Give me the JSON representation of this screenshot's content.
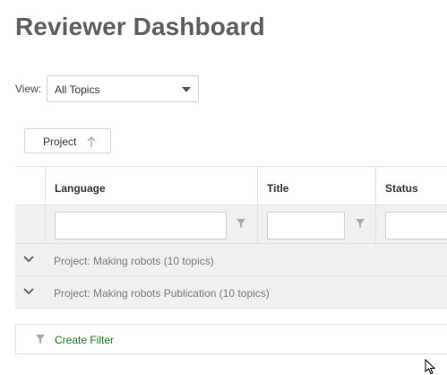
{
  "page": {
    "title": "Reviewer Dashboard"
  },
  "view": {
    "label": "View:",
    "selected": "All Topics"
  },
  "grouping": {
    "chip_label": "Project",
    "sort_direction": "ascending"
  },
  "grid": {
    "columns": [
      {
        "key": "language",
        "label": "Language"
      },
      {
        "key": "title",
        "label": "Title"
      },
      {
        "key": "status",
        "label": "Status"
      }
    ],
    "filters": {
      "language": "",
      "title": "",
      "status": ""
    },
    "groups": [
      {
        "label": "Project: Making robots (10 topics)",
        "expanded": false
      },
      {
        "label": "Project: Making robots Publication (10 topics)",
        "expanded": false
      }
    ]
  },
  "footer": {
    "create_filter_label": "Create Filter"
  },
  "colors": {
    "link": "#1e7a1e",
    "title": "#5f5f5f",
    "row_bg": "#f0f0f0",
    "border": "#e0e0e0"
  }
}
